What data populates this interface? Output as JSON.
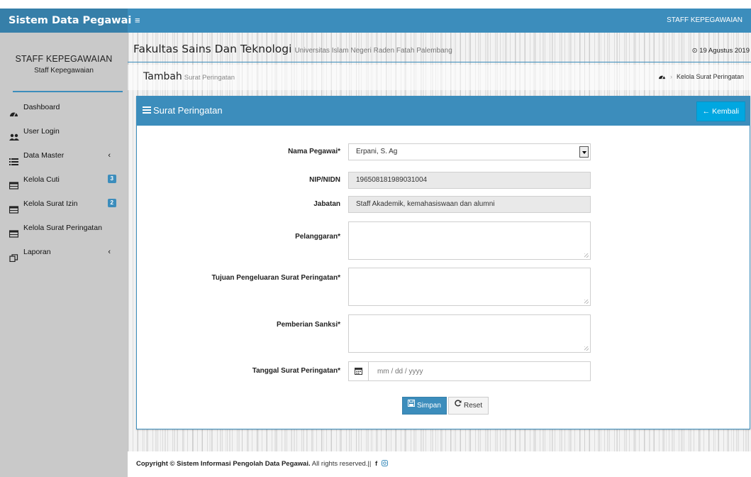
{
  "topbar": {
    "brand": "Sistem Data Pegawai",
    "menu_toggle_icon": "bars-icon",
    "user": "STAFF KEPEGAWAIAN"
  },
  "sidebar": {
    "user_name": "STAFF KEPEGAWAIAN",
    "user_role": "Staff Kepegawaian",
    "items": [
      {
        "label": "Dashboard",
        "icon": "tachometer-icon"
      },
      {
        "label": "User Login",
        "icon": "users-icon"
      },
      {
        "label": "Data Master",
        "icon": "list-icon",
        "chevron": "‹"
      },
      {
        "label": "Kelola Cuti",
        "icon": "table-icon",
        "badge": "3"
      },
      {
        "label": "Kelola Surat Izin",
        "icon": "table-icon",
        "badge": "2"
      },
      {
        "label": "Kelola Surat Peringatan",
        "icon": "table-icon"
      },
      {
        "label": "Laporan",
        "icon": "copy-icon",
        "chevron": "‹"
      }
    ]
  },
  "header": {
    "title": "Fakultas Sains Dan Teknologi",
    "subtitle": "Universitas Islam Negeri Raden Fatah Palembang",
    "date": "19 Agustus 2019"
  },
  "subheader": {
    "title": "Tambah",
    "subtitle": "Surat Peringatan",
    "breadcrumb": "Kelola Surat Peringatan"
  },
  "box": {
    "title": "Surat Peringatan",
    "back_button": "Kembali"
  },
  "form": {
    "nama_label": "Nama Pegawai*",
    "nama_value": "Erpani, S. Ag",
    "nip_label": "NIP/NIDN",
    "nip_value": "196508181989031004",
    "jabatan_label": "Jabatan",
    "jabatan_value": "Staff Akademik, kemahasiswaan dan alumni",
    "pelanggaran_label": "Pelanggaran*",
    "tujuan_label": "Tujuan Pengeluaran Surat Peringatan*",
    "sanksi_label": "Pemberian Sanksi*",
    "tanggal_label": "Tanggal Surat Peringatan*",
    "tanggal_placeholder": "mm / dd / yyyy",
    "save_button": "Simpan",
    "reset_button": "Reset"
  },
  "footer": {
    "copyright": "Copyright © Sistem Informasi Pengolah Data Pegawai.",
    "rights": "All rights reserved.||"
  },
  "colors": {
    "primary": "#3c8dbc",
    "brand_dark": "#367fa9",
    "back_button": "#00a7e1",
    "sidebar_bg": "#c9c9c9"
  }
}
